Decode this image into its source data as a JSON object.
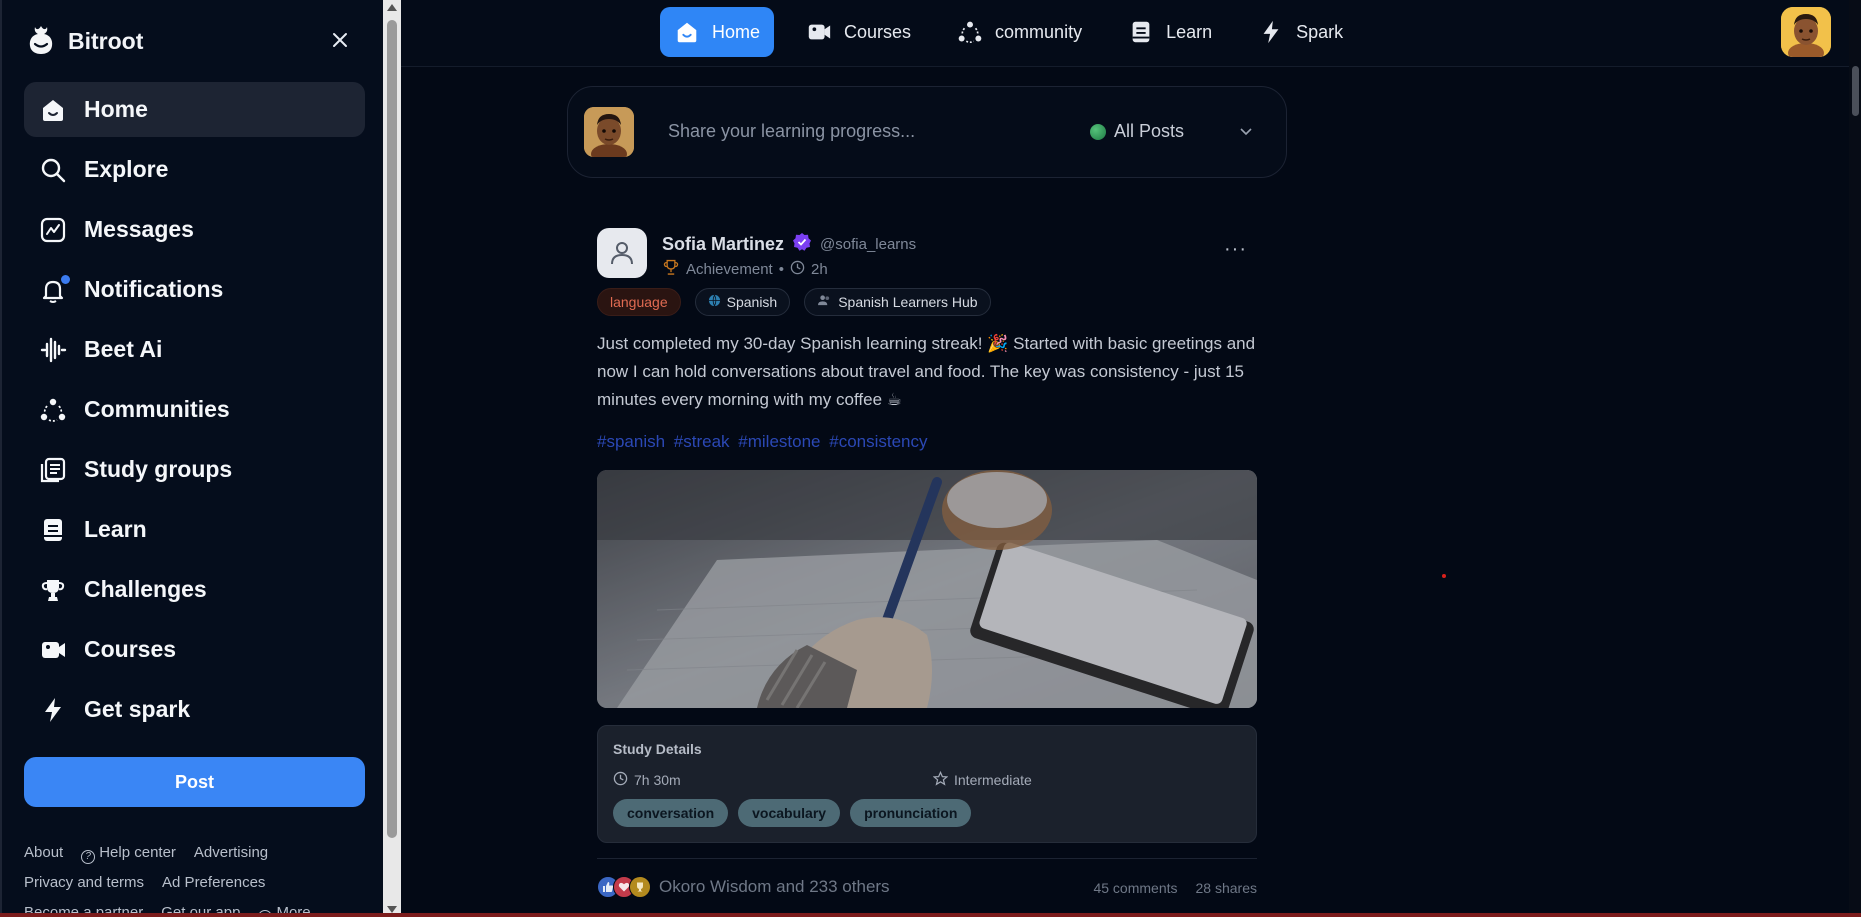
{
  "brand": {
    "name": "Bitroot"
  },
  "sidebar": {
    "items": [
      {
        "label": "Home",
        "icon": "home-icon",
        "active": true
      },
      {
        "label": "Explore",
        "icon": "search-icon"
      },
      {
        "label": "Messages",
        "icon": "messages-icon"
      },
      {
        "label": "Notifications",
        "icon": "bell-icon"
      },
      {
        "label": "Beet Ai",
        "icon": "waveform-icon"
      },
      {
        "label": "Communities",
        "icon": "communities-icon"
      },
      {
        "label": "Study groups",
        "icon": "study-groups-icon"
      },
      {
        "label": "Learn",
        "icon": "learn-icon"
      },
      {
        "label": "Challenges",
        "icon": "trophy-icon"
      },
      {
        "label": "Courses",
        "icon": "video-icon"
      },
      {
        "label": "Get spark",
        "icon": "lightning-icon"
      }
    ],
    "post_label": "Post",
    "footer": {
      "about": "About",
      "help": "Help center",
      "advertising": "Advertising",
      "privacy": "Privacy and terms",
      "ad_prefs": "Ad Preferences",
      "partner": "Become a partner",
      "app": "Get our app",
      "more": "More"
    }
  },
  "topnav": {
    "items": [
      {
        "label": "Home",
        "icon": "home-icon",
        "active": true
      },
      {
        "label": "Courses",
        "icon": "video-icon"
      },
      {
        "label": "community",
        "icon": "communities-icon"
      },
      {
        "label": "Learn",
        "icon": "learn-icon"
      },
      {
        "label": "Spark",
        "icon": "lightning-icon"
      }
    ]
  },
  "composer": {
    "placeholder": "Share your learning progress...",
    "filter": "All Posts"
  },
  "post": {
    "author": "Sofia Martinez",
    "handle": "@sofia_learns",
    "type": "Achievement",
    "time": "2h",
    "tags": [
      "language",
      "Spanish",
      "Spanish Learners Hub"
    ],
    "body": "Just completed my 30-day Spanish learning streak! 🎉 Started with basic greetings and now I can hold conversations about travel and food. The key was consistency - just 15 minutes every morning with my coffee ☕",
    "hashtags": [
      "#spanish",
      "#streak",
      "#milestone",
      "#consistency"
    ],
    "details": {
      "title": "Study Details",
      "duration": "7h 30m",
      "level": "Intermediate",
      "skills": [
        "conversation",
        "vocabulary",
        "pronunciation"
      ]
    },
    "reactions_text": "Okoro Wisdom and 233 others",
    "comments": "45 comments",
    "shares": "28 shares"
  },
  "colors": {
    "accent": "#2f86f6",
    "background": "#030915",
    "sidebar": "#050d1c"
  }
}
